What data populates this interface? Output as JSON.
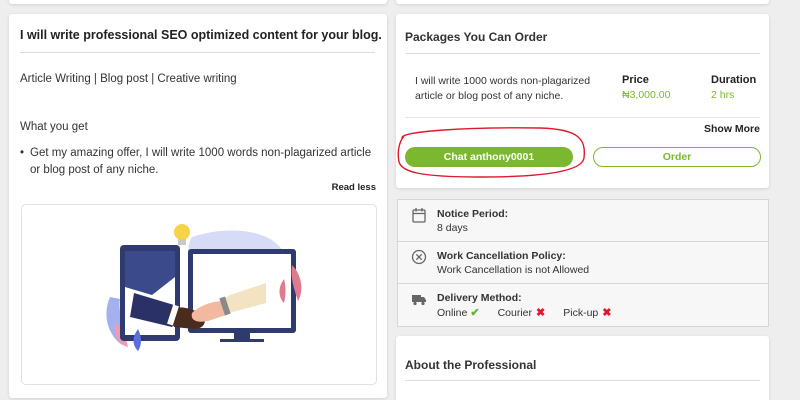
{
  "gig": {
    "title": "I will write professional SEO optimized content for your blog.",
    "tags": "Article Writing | Blog post | Creative writing",
    "what_you_get_heading": "What you get",
    "bullets": [
      "Get my amazing offer, I will write 1000 words non-plagarized article or blog post of any niche."
    ],
    "read_less": "Read less"
  },
  "packages": {
    "title": "Packages You Can Order",
    "item": {
      "description": "I will write 1000 words non-plagarized article or blog post of any niche.",
      "price_label": "Price",
      "price_value": "₦3,000.00",
      "duration_label": "Duration",
      "duration_value": "2 hrs"
    },
    "show_more": "Show More",
    "chat_button": "Chat anthony0001",
    "order_button": "Order"
  },
  "details": {
    "notice_label": "Notice Period:",
    "notice_value": "8 days",
    "cancel_label": "Work Cancellation Policy:",
    "cancel_value": "Work Cancellation is not Allowed",
    "delivery_label": "Delivery Method:",
    "delivery_options": [
      {
        "name": "Online",
        "available": true
      },
      {
        "name": "Courier",
        "available": false
      },
      {
        "name": "Pick-up",
        "available": false
      }
    ]
  },
  "about": {
    "title": "About the Professional"
  },
  "colors": {
    "accent_green": "#7cb82f",
    "check_green": "#5cb82b",
    "cross_red": "#e0182d",
    "annotation_red": "#e0182d"
  }
}
